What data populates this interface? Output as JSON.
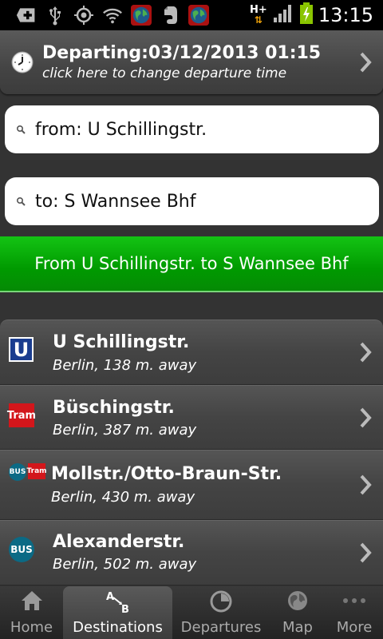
{
  "status_bar": {
    "time": "13:15",
    "network": "H+",
    "icons": [
      "add-box-icon",
      "usb-icon",
      "gps-icon",
      "wifi-icon",
      "globe-app-icon",
      "evernote-icon",
      "globe-app-icon"
    ]
  },
  "departure": {
    "title": "Departing:03/12/2013 01:15",
    "subtitle": "click here to change departure time"
  },
  "from_field": {
    "value": "from: U Schillingstr."
  },
  "to_field": {
    "value": "to: S Wannsee Bhf"
  },
  "route_banner": {
    "text": "From U Schillingstr. to S Wannsee Bhf"
  },
  "stations": [
    {
      "name": "U Schillingstr.",
      "location": "Berlin, 138 m. away",
      "modes": [
        "U"
      ]
    },
    {
      "name": "Büschingstr.",
      "location": "Berlin, 387 m. away",
      "modes": [
        "Tram"
      ]
    },
    {
      "name": "Mollstr./Otto-Braun-Str.",
      "location": "Berlin, 430 m. away",
      "modes": [
        "BUS",
        "Tram"
      ]
    },
    {
      "name": "Alexanderstr.",
      "location": "Berlin, 502 m. away",
      "modes": [
        "BUS"
      ]
    }
  ],
  "nav": {
    "home": "Home",
    "destinations": "Destinations",
    "destinations_a": "A",
    "destinations_b": "B",
    "departures": "Departures",
    "map": "Map",
    "more": "More"
  },
  "colors": {
    "route_banner": "#009a00",
    "u_badge": "#1b3d8f",
    "tram_badge": "#d3161b",
    "bus_badge": "#0b6a85"
  }
}
